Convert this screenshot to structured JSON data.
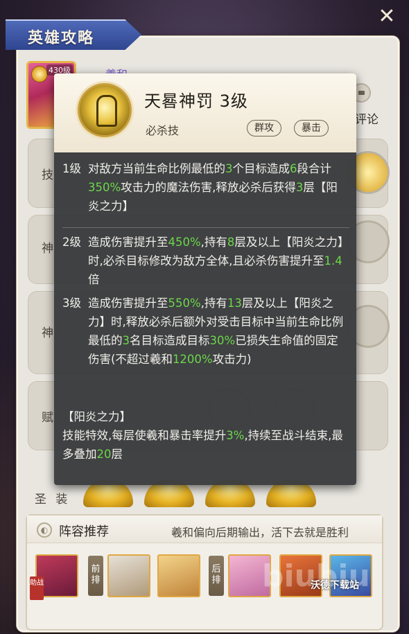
{
  "window": {
    "title": "英雄攻略",
    "close_label": "✕"
  },
  "hero": {
    "level": "430级",
    "name": "羲和"
  },
  "comment": {
    "label": "评论"
  },
  "background_rows": {
    "labels": [
      "技",
      "神",
      "神",
      "赋",
      "圣 装"
    ]
  },
  "skill": {
    "name": "天晷神罚 3级",
    "type": "必杀技",
    "tags": [
      "群攻",
      "暴击"
    ],
    "levels": [
      {
        "num": "1级",
        "segments": [
          {
            "t": "对敌方当前生命比例最低的",
            "hl": false
          },
          {
            "t": "3",
            "hl": true
          },
          {
            "t": "个目标造成",
            "hl": false
          },
          {
            "t": "6",
            "hl": true
          },
          {
            "t": "段合计",
            "hl": false
          },
          {
            "t": "350%",
            "hl": true
          },
          {
            "t": "攻击力的魔法伤害,释放必杀后获得",
            "hl": false
          },
          {
            "t": "3",
            "hl": true
          },
          {
            "t": "层【阳炎之力】",
            "hl": false
          }
        ]
      },
      {
        "num": "2级",
        "segments": [
          {
            "t": "造成伤害提升至",
            "hl": false
          },
          {
            "t": "450%",
            "hl": true
          },
          {
            "t": ",持有",
            "hl": false
          },
          {
            "t": "8",
            "hl": true
          },
          {
            "t": "层及以上【阳炎之力】时,必杀目标修改为敌方全体,且必杀伤害提升至",
            "hl": false
          },
          {
            "t": "1.4",
            "hl": true
          },
          {
            "t": "倍",
            "hl": false
          }
        ]
      },
      {
        "num": "3级",
        "segments": [
          {
            "t": "造成伤害提升至",
            "hl": false
          },
          {
            "t": "550%",
            "hl": true
          },
          {
            "t": ",持有",
            "hl": false
          },
          {
            "t": "13",
            "hl": true
          },
          {
            "t": "层及以上【阳炎之力】时,释放必杀后额外对受击目标中当前生命比例最低的",
            "hl": false
          },
          {
            "t": "3",
            "hl": true
          },
          {
            "t": "名目标造成目标",
            "hl": false
          },
          {
            "t": "30%",
            "hl": true
          },
          {
            "t": "已损失生命值的固定伤害(不超过羲和",
            "hl": false
          },
          {
            "t": "1200%",
            "hl": true
          },
          {
            "t": "攻击力)",
            "hl": false
          }
        ]
      }
    ],
    "buff": {
      "title": "【阳炎之力】",
      "segments": [
        {
          "t": "技能特效,每层使羲和暴击率提升",
          "hl": false
        },
        {
          "t": "3%",
          "hl": true
        },
        {
          "t": ",持续至战斗结束,最多叠加",
          "hl": false
        },
        {
          "t": "20",
          "hl": true
        },
        {
          "t": "层",
          "hl": false
        }
      ]
    }
  },
  "lineup": {
    "title": "阵容推荐",
    "note": "羲和偏向后期输出，活下去就是胜利",
    "aid_tag": "助战",
    "front_tag": "前排",
    "back_tag": "后排"
  },
  "watermark": {
    "big": "biubiu",
    "small": "沃德下载站"
  },
  "colors": {
    "highlight": "#6dd64a",
    "banner": "#3d56a4",
    "popup_bg": "#3a3c3e"
  }
}
